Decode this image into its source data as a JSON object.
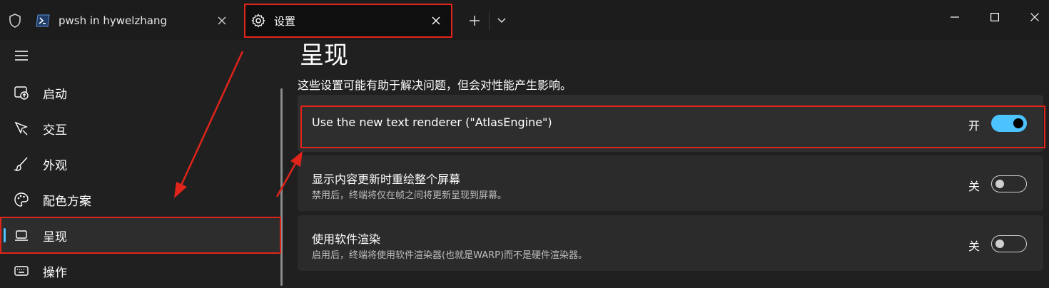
{
  "tabs": [
    {
      "label": "pwsh in hywelzhang",
      "icon": "powershell-icon",
      "selected": false
    },
    {
      "label": "设置",
      "icon": "gear-icon",
      "selected": true
    }
  ],
  "sidebar": {
    "items": [
      {
        "label": "启动",
        "icon": "startup-icon"
      },
      {
        "label": "交互",
        "icon": "interaction-icon"
      },
      {
        "label": "外观",
        "icon": "brush-icon"
      },
      {
        "label": "配色方案",
        "icon": "palette-icon"
      },
      {
        "label": "呈现",
        "icon": "laptop-icon",
        "selected": true
      },
      {
        "label": "操作",
        "icon": "keyboard-icon"
      }
    ]
  },
  "main": {
    "title": "呈现",
    "description": "这些设置可能有助于解决问题，但会对性能产生影响。",
    "settings": [
      {
        "title": "Use the new text renderer (\"AtlasEngine\")",
        "state_label": "开",
        "on": true
      },
      {
        "title": "显示内容更新时重绘整个屏幕",
        "subtitle": "禁用后，终端将仅在帧之间将更新呈现到屏幕。",
        "state_label": "关",
        "on": false
      },
      {
        "title": "使用软件渲染",
        "subtitle": "启用后，终端将使用软件渲染器(也就是WARP)而不是硬件渲染器。",
        "state_label": "关",
        "on": false
      }
    ]
  },
  "colors": {
    "accent": "#4cc2ff",
    "annotation": "#e0241a",
    "background": "#202020",
    "card": "#2b2b2b"
  }
}
